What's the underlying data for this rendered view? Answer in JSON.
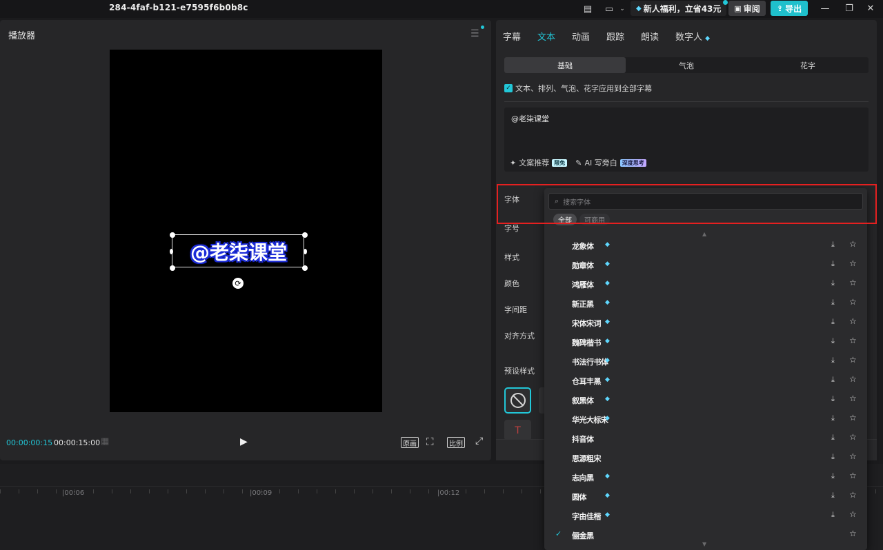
{
  "titlebar": {
    "doc_id": "284-4faf-b121-e7595f6b0b8c",
    "promo_label": "新人福利，立省43元",
    "review_label": "审阅",
    "export_label": "导出",
    "icons": [
      "subtitle-layout-icon",
      "layout-icon",
      "chevron-down-icon",
      "gem-icon",
      "minimize-icon",
      "restore-icon",
      "close-icon"
    ]
  },
  "player": {
    "title": "播放器",
    "caption": "@老柒课堂",
    "time_current": "00:00:00:15",
    "time_total": "00:00:15:00",
    "ratio_label": "原画",
    "aspect_label": "比例"
  },
  "inspector": {
    "tabs": [
      {
        "label": "字幕",
        "active": false
      },
      {
        "label": "文本",
        "active": true
      },
      {
        "label": "动画",
        "active": false
      },
      {
        "label": "跟踪",
        "active": false
      },
      {
        "label": "朗读",
        "active": false
      },
      {
        "label": "数字人",
        "active": false
      }
    ],
    "subtabs": [
      {
        "label": "基础",
        "active": true
      },
      {
        "label": "气泡",
        "active": false
      },
      {
        "label": "花字",
        "active": false
      }
    ],
    "apply_all_label": "文本、排列、气泡、花字应用到全部字幕",
    "apply_all_checked": true,
    "text_value": "@老柒课堂",
    "ai_copy_label": "文案推荐",
    "ai_copy_badge": "限免",
    "ai_write_label": "AI 写旁白",
    "ai_write_badge": "深度思考",
    "fields": {
      "font": "字体",
      "size": "字号",
      "style": "样式",
      "color": "颜色",
      "spacing": "字间距",
      "align": "对齐方式",
      "preset": "预设样式"
    }
  },
  "font_dropdown": {
    "search_placeholder": "搜索字体",
    "filters": [
      {
        "label": "全部",
        "active": true
      },
      {
        "label": "可商用",
        "active": false
      }
    ],
    "fonts": [
      {
        "name": "龙象体",
        "vip": true,
        "download": true,
        "selected": false
      },
      {
        "name": "勋章体",
        "vip": true,
        "download": true,
        "selected": false
      },
      {
        "name": "鸿雁体",
        "vip": true,
        "download": true,
        "selected": false
      },
      {
        "name": "新正黑",
        "vip": true,
        "download": true,
        "selected": false
      },
      {
        "name": "宋体宋词",
        "vip": true,
        "download": true,
        "selected": false
      },
      {
        "name": "魏碑楷书",
        "vip": true,
        "download": true,
        "selected": false
      },
      {
        "name": "书法行书体",
        "vip": true,
        "download": true,
        "selected": false
      },
      {
        "name": "仓耳丰黑",
        "vip": true,
        "download": true,
        "selected": false
      },
      {
        "name": "叙黑体",
        "vip": true,
        "download": true,
        "selected": false
      },
      {
        "name": "华光大标宋",
        "vip": true,
        "download": true,
        "selected": false
      },
      {
        "name": "抖音体",
        "vip": false,
        "download": true,
        "selected": false
      },
      {
        "name": "思源粗宋",
        "vip": false,
        "download": true,
        "selected": false
      },
      {
        "name": "志向黑",
        "vip": true,
        "download": true,
        "selected": false
      },
      {
        "name": "圆体",
        "vip": true,
        "download": true,
        "selected": false
      },
      {
        "name": "字由佳楷",
        "vip": true,
        "download": true,
        "selected": false
      },
      {
        "name": "俪金黑",
        "vip": false,
        "download": false,
        "selected": true
      }
    ]
  },
  "timeline": {
    "ticks": [
      "00:06",
      "00:09",
      "00:12"
    ]
  },
  "colors": {
    "accent": "#22c7d8",
    "highlight": "#e52020",
    "caption_outline": "#1b2bd8"
  }
}
